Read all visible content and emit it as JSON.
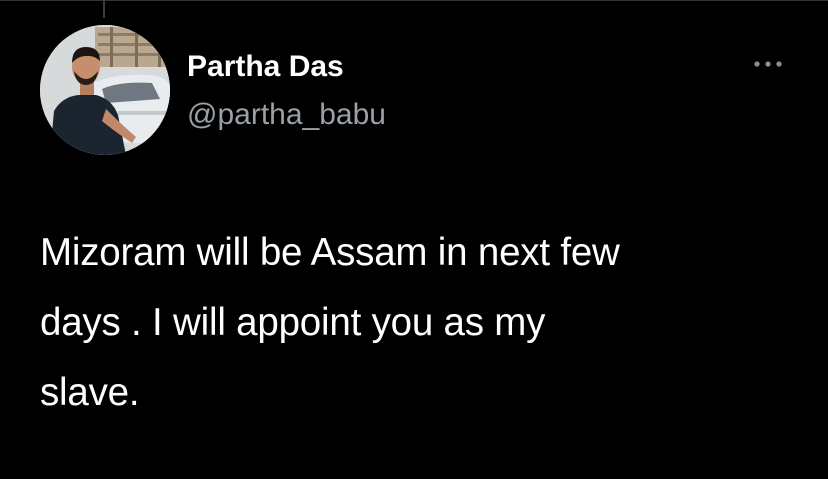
{
  "tweet": {
    "author": {
      "display_name": "Partha Das",
      "handle": "@partha_babu",
      "avatar_icon": "profile-photo"
    },
    "more_icon": "more-horizontal-icon",
    "text": "Mizoram will be Assam in next few\ndays .  I will appoint you as my\nslave."
  },
  "colors": {
    "background": "#000000",
    "primary_text": "#ffffff",
    "secondary_text": "#9aa0a6",
    "icon": "#8b9096"
  }
}
